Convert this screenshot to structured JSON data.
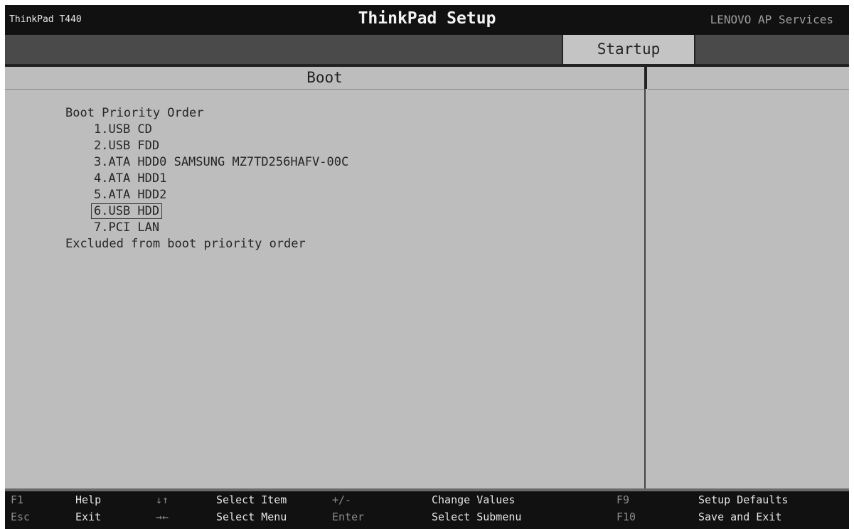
{
  "titlebar": {
    "model": "ThinkPad T440",
    "title": "ThinkPad Setup",
    "services": "LENOVO AP Services"
  },
  "tabs": [
    {
      "label": "Startup",
      "active": true
    }
  ],
  "panel": {
    "header": "Boot",
    "heading": "Boot Priority Order",
    "items": [
      {
        "label": "1.USB CD"
      },
      {
        "label": "2.USB FDD"
      },
      {
        "label": "3.ATA HDD0 SAMSUNG MZ7TD256HAFV-00C"
      },
      {
        "label": "4.ATA HDD1"
      },
      {
        "label": "5.ATA HDD2"
      },
      {
        "label": "6.USB HDD",
        "selected": true
      },
      {
        "label": "7.PCI LAN"
      }
    ],
    "excluded": "Excluded from boot priority order"
  },
  "footer": {
    "row1": [
      {
        "key": "F1",
        "label": "Help"
      },
      {
        "key": "↓↑",
        "label": "Select Item"
      },
      {
        "key": "+/-",
        "label": "Change Values"
      },
      {
        "key": "F9",
        "label": "Setup Defaults"
      }
    ],
    "row2": [
      {
        "key": "Esc",
        "label": "Exit"
      },
      {
        "key": "→←",
        "label": "Select Menu"
      },
      {
        "key": "Enter",
        "label": "Select Submenu"
      },
      {
        "key": "F10",
        "label": "Save and Exit"
      }
    ]
  },
  "colors": {
    "background": "#bdbdbd",
    "titlebar": "#111111",
    "tabbar": "#4a4a4a",
    "active_tab": "#c4c4c4"
  }
}
